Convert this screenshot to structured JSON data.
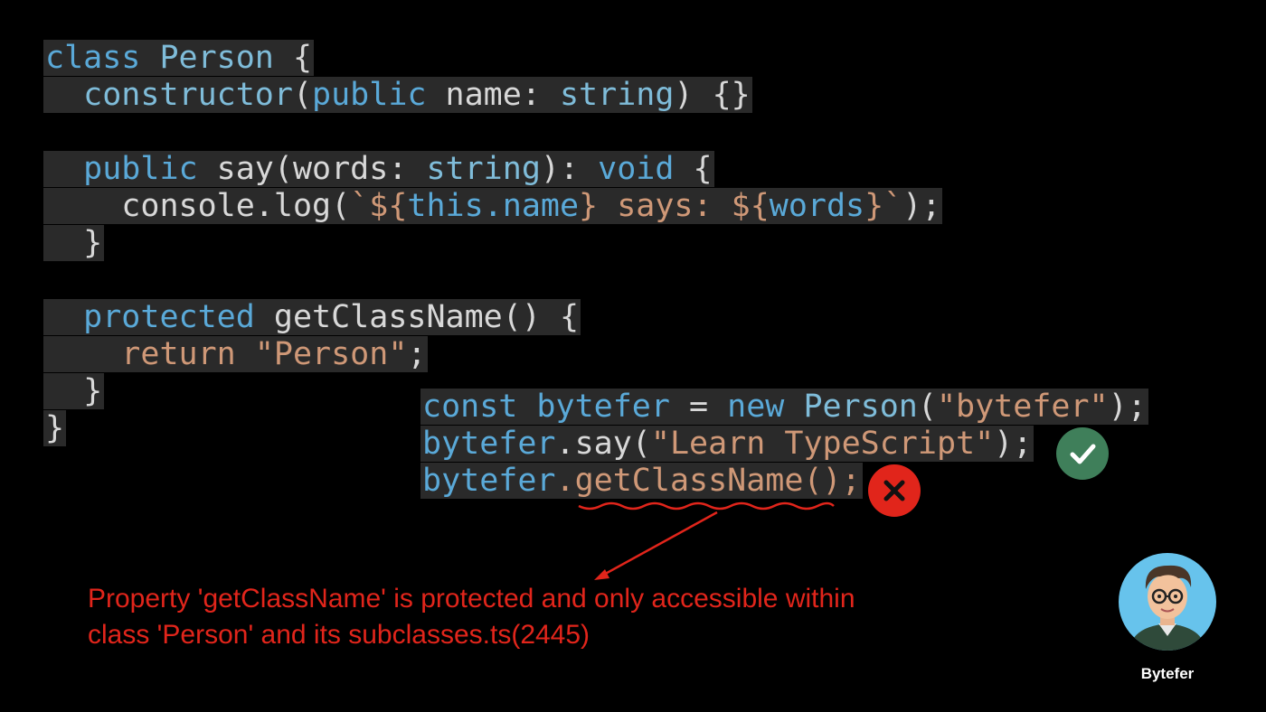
{
  "class_code": {
    "l1": {
      "kw": "class",
      "sp": " ",
      "name": "Person",
      "rest": " {"
    },
    "l2": {
      "indent": "  ",
      "fn": "constructor",
      "p1": "(",
      "mod": "public",
      "p2": " name: ",
      "type": "string",
      "p3": ") {}"
    },
    "l3": {
      "indent": "  ",
      "mod": "public",
      "p1": " say(words: ",
      "type": "string",
      "p2": "): ",
      "ret": "void",
      "p3": " {"
    },
    "l4": {
      "indent": "    ",
      "p1": "console.log(",
      "t1": "`${",
      "kw": "this",
      "p2": ".name",
      "t2": "} says: ${",
      "p3": "words",
      "t3": "}`",
      "p4": ");"
    },
    "l5": {
      "text": "  }"
    },
    "l6": {
      "indent": "  ",
      "mod": "protected",
      "p1": " getClassName() {"
    },
    "l7": {
      "indent": "    ",
      "kw": "return",
      "sp": " ",
      "str": "\"Person\"",
      "p1": ";"
    },
    "l8": {
      "text": "  }"
    },
    "l9": {
      "text": "}"
    }
  },
  "usage_code": {
    "l1": {
      "kw": "const",
      "var": " bytefer",
      "p1": " = ",
      "kw2": "new",
      "sp": " ",
      "cls": "Person",
      "p2": "(",
      "str": "\"bytefer\"",
      "p3": ");"
    },
    "l2": {
      "var": "bytefer",
      "p1": ".say(",
      "str": "\"Learn TypeScript\"",
      "p2": ");"
    },
    "l3": {
      "var": "bytefer",
      "p1": ".getClassName();"
    }
  },
  "error_message": {
    "line1": "Property 'getClassName' is protected and only accessible within",
    "line2": "class 'Person' and its subclasses.ts(2445)"
  },
  "icons": {
    "ok": "checkmark-icon",
    "bad": "cross-icon"
  },
  "colors": {
    "error": "#e1251b",
    "ok": "#3f7f5a",
    "keyword": "#5aa9d8",
    "string": "#cf9877"
  },
  "author": {
    "name": "Bytefer"
  }
}
